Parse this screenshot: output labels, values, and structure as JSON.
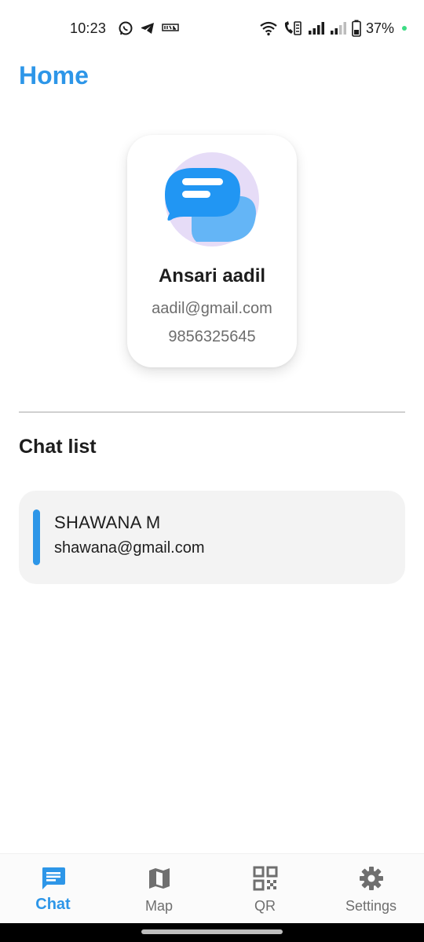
{
  "status_bar": {
    "time": "10:23",
    "battery": "37%",
    "app_icons": [
      "whatsapp-icon",
      "telegram-icon",
      "app-icon"
    ],
    "system_icons": [
      "wifi-icon",
      "wifi-calling-icon",
      "signal-icon",
      "signal-weak-icon",
      "battery-icon"
    ]
  },
  "header": {
    "title": "Home"
  },
  "profile": {
    "name": "Ansari aadil",
    "email": "aadil@gmail.com",
    "phone": "9856325645"
  },
  "chat_section": {
    "title": "Chat list",
    "items": [
      {
        "name": "SHAWANA M",
        "email": "shawana@gmail.com"
      }
    ]
  },
  "bottom_nav": {
    "items": [
      {
        "label": "Chat",
        "icon": "chat-icon",
        "active": true
      },
      {
        "label": "Map",
        "icon": "map-icon",
        "active": false
      },
      {
        "label": "QR",
        "icon": "qr-code-icon",
        "active": false
      },
      {
        "label": "Settings",
        "icon": "settings-gear-icon",
        "active": false
      }
    ]
  },
  "colors": {
    "accent": "#2d96e8",
    "card_bg": "#f3f3f3",
    "avatar_bg": "#e6dcf7"
  }
}
